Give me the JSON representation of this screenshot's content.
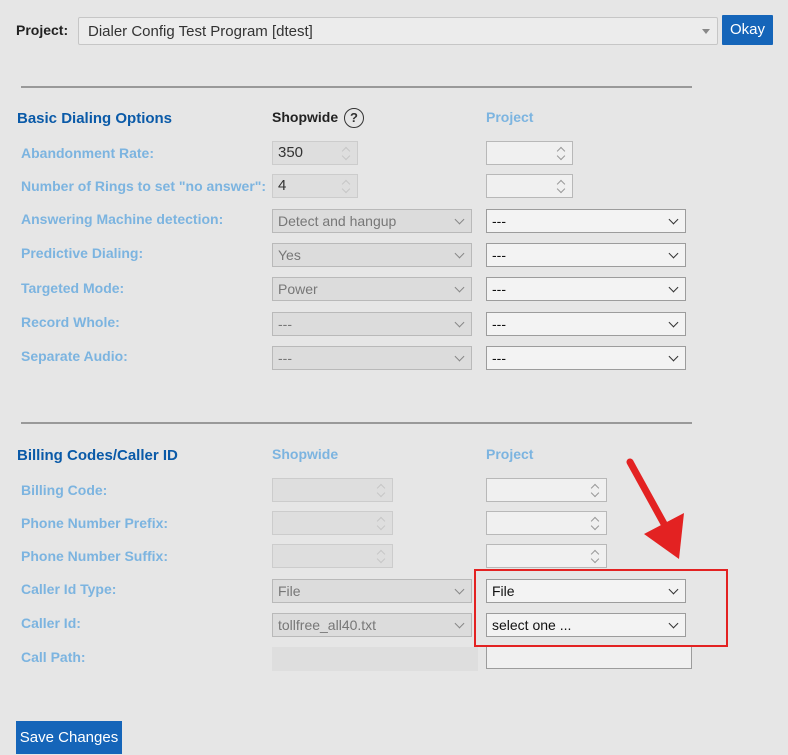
{
  "project_bar": {
    "label": "Project:",
    "selected": "Dialer Config Test Program [dtest]",
    "okay_label": "Okay"
  },
  "basic": {
    "title": "Basic Dialing Options",
    "shopwide_header": "Shopwide",
    "help_glyph": "?",
    "project_header": "Project",
    "rows": [
      {
        "label": "Abandonment Rate:",
        "shopwide": "350",
        "project": ""
      },
      {
        "label": "Number of Rings to set \"no answer\":",
        "shopwide": "4",
        "project": ""
      },
      {
        "label": "Answering Machine detection:",
        "shopwide": "Detect and hangup",
        "project": "---"
      },
      {
        "label": "Predictive Dialing:",
        "shopwide": "Yes",
        "project": "---"
      },
      {
        "label": "Targeted Mode:",
        "shopwide": "Power",
        "project": "---"
      },
      {
        "label": "Record Whole:",
        "shopwide": "---",
        "project": "---"
      },
      {
        "label": "Separate Audio:",
        "shopwide": "---",
        "project": "---"
      }
    ]
  },
  "billing": {
    "title": "Billing Codes/Caller ID",
    "shopwide_header": "Shopwide",
    "project_header": "Project",
    "rows": [
      {
        "label": "Billing Code:",
        "shopwide": "",
        "project": ""
      },
      {
        "label": "Phone Number Prefix:",
        "shopwide": "",
        "project": ""
      },
      {
        "label": "Phone Number Suffix:",
        "shopwide": "",
        "project": ""
      },
      {
        "label": "Caller Id Type:",
        "shopwide": "File",
        "project": "File"
      },
      {
        "label": "Caller Id:",
        "shopwide": "tollfree_all40.txt",
        "project": "select one ..."
      },
      {
        "label": "Call Path:",
        "shopwide": "",
        "project": ""
      }
    ]
  },
  "annotation": {
    "color": "#e32222"
  },
  "save_label": "Save Changes",
  "colors": {
    "accent": "#1565b9",
    "section_title": "#0a5aa8",
    "label": "#7cb4e0",
    "background": "#e6e6e6"
  }
}
